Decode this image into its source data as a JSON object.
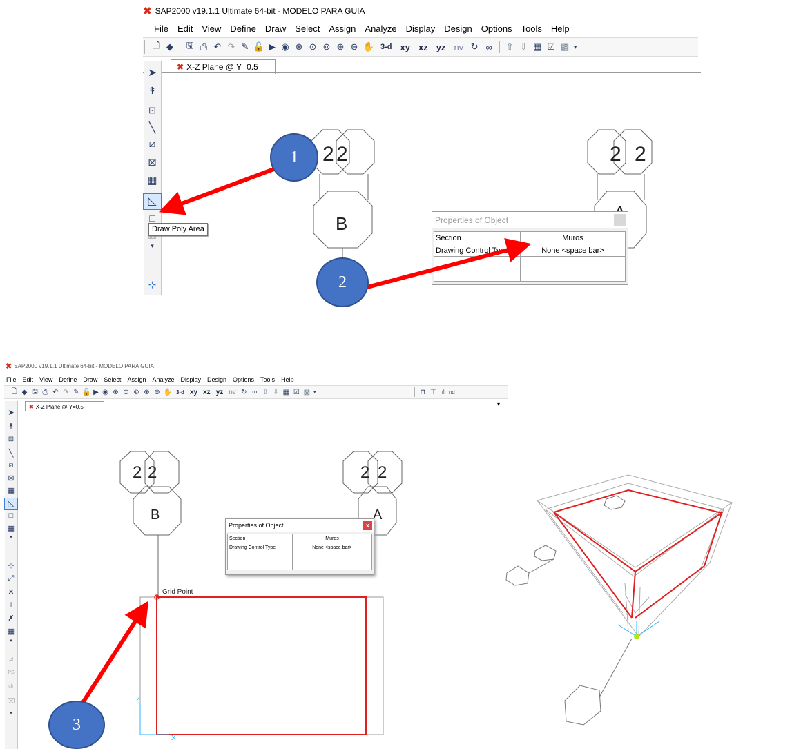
{
  "app": {
    "title": "SAP2000 v19.1.1 Ultimate 64-bit - MODELO PARA GUIA",
    "logo_glyph": "✖",
    "accent_color": "#d62e1e"
  },
  "menu": [
    "File",
    "Edit",
    "View",
    "Define",
    "Draw",
    "Select",
    "Assign",
    "Analyze",
    "Display",
    "Design",
    "Options",
    "Tools",
    "Help"
  ],
  "toolbar": {
    "icons": [
      "new-model-icon",
      "open-icon",
      "save-icon",
      "print-icon",
      "undo-icon",
      "redo-icon",
      "pencil-icon",
      "lock-icon",
      "run-icon",
      "run-now-icon",
      "zoom-window-icon",
      "zoom-restore-icon",
      "zoom-previous-icon",
      "zoom-in-icon",
      "zoom-out-icon",
      "pan-icon"
    ],
    "view_labels": [
      "3-d",
      "xy",
      "xz",
      "yz",
      "nv"
    ],
    "right_icons": [
      "rotate-icon",
      "glasses-icon",
      "move-up-icon",
      "move-down-icon",
      "grid-icon",
      "check-icon",
      "set-display-icon"
    ],
    "bottom_extra": "nd"
  },
  "tab": {
    "label": "X-Z Plane @ Y=0.5"
  },
  "side_toolbar_top": [
    "pointer-icon",
    "reshape-icon",
    "draw-joint-icon",
    "draw-frame-icon",
    "quick-draw-frame-icon",
    "draw-braces-icon",
    "quick-draw-area-icon",
    "draw-poly-area-icon",
    "draw-rectangle-area-icon",
    "draw-area-grid-icon"
  ],
  "side_toolbar_bottom": [
    "snap-points-icon",
    "snap-ends-icon",
    "snap-intersections-icon",
    "snap-perpendicular-icon",
    "snap-lines-icon",
    "snap-fine-grid-icon",
    "ps-icon",
    "clr-icon",
    "lock-snap-icon"
  ],
  "tooltip": {
    "label": "Draw Poly Area"
  },
  "grid_bubbles": {
    "top": [
      "2",
      "2",
      "2",
      "2"
    ],
    "middle": [
      "B",
      "A"
    ]
  },
  "properties": {
    "title": "Properties of Object",
    "rows": [
      {
        "label": "Section",
        "value": "Muros"
      },
      {
        "label": "Drawing Control Type",
        "value": "None  <space bar>"
      },
      {
        "label": "",
        "value": ""
      },
      {
        "label": "",
        "value": ""
      }
    ],
    "close_glyph": "x"
  },
  "canvas": {
    "grid_point_label": "Grid Point",
    "axis_z": "Z",
    "axis_x": "X"
  },
  "callouts": [
    "1",
    "2",
    "3"
  ],
  "colors": {
    "arrow": "#ff0000",
    "callout": "#4472c4",
    "polygon": "#e02020"
  }
}
